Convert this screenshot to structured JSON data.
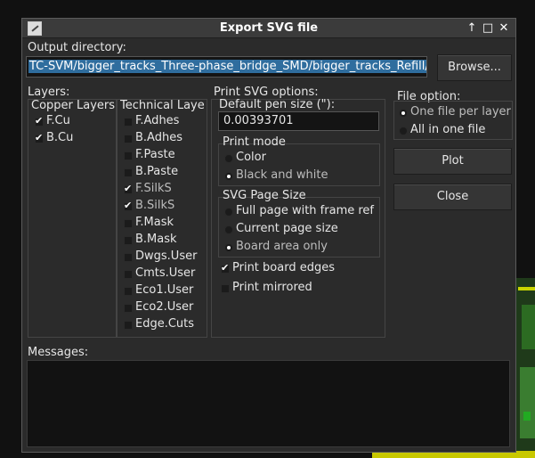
{
  "dialog": {
    "title": "Export SVG file",
    "icons": {
      "app": "kicad-app-icon",
      "help": "up-arrow-icon",
      "maximize": "maximize-icon",
      "close": "close-icon"
    },
    "help_glyph": "↑",
    "max_glyph": "□",
    "close_glyph": "✕"
  },
  "output": {
    "label": "Output directory:",
    "value": "TC-SVM/bigger_tracks_Three-phase_bridge_SMD/bigger_tracks_Refill/",
    "browse": "Browse..."
  },
  "layers": {
    "label": "Layers:",
    "copper_header": "Copper Layers",
    "technical_header": "Technical Laye",
    "copper": [
      {
        "name": "F.Cu",
        "checked": true
      },
      {
        "name": "B.Cu",
        "checked": true
      }
    ],
    "technical": [
      {
        "name": "F.Adhes",
        "checked": false
      },
      {
        "name": "B.Adhes",
        "checked": false
      },
      {
        "name": "F.Paste",
        "checked": false
      },
      {
        "name": "B.Paste",
        "checked": false
      },
      {
        "name": "F.SilkS",
        "checked": true
      },
      {
        "name": "B.SilkS",
        "checked": true
      },
      {
        "name": "F.Mask",
        "checked": false
      },
      {
        "name": "B.Mask",
        "checked": false
      },
      {
        "name": "Dwgs.User",
        "checked": false
      },
      {
        "name": "Cmts.User",
        "checked": false
      },
      {
        "name": "Eco1.User",
        "checked": false
      },
      {
        "name": "Eco2.User",
        "checked": false
      },
      {
        "name": "Edge.Cuts",
        "checked": false
      }
    ]
  },
  "print": {
    "label": "Print SVG options:",
    "pen_label": "Default pen size (\"):",
    "pen_value": "0.00393701",
    "mode_label": "Print mode",
    "mode_color": "Color",
    "mode_bw": "Black and white",
    "page_label": "SVG Page Size",
    "page_full": "Full page with  frame ref",
    "page_current": "Current page size",
    "page_board": "Board area only",
    "board_edges": "Print board edges",
    "mirrored": "Print mirrored"
  },
  "file_option": {
    "label": "File option:",
    "one": "One file per layer",
    "all": "All in one file"
  },
  "buttons": {
    "plot": "Plot",
    "close": "Close"
  },
  "messages": {
    "label": "Messages:"
  }
}
